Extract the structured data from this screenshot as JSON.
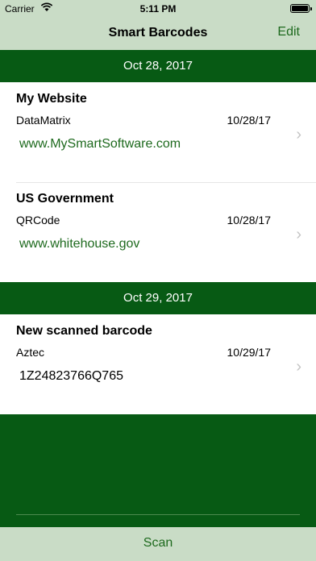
{
  "status": {
    "carrier": "Carrier",
    "time": "5:11 PM"
  },
  "nav": {
    "title": "Smart Barcodes",
    "edit_label": "Edit"
  },
  "sections": [
    {
      "header": "Oct 28, 2017",
      "items": [
        {
          "name": "My Website",
          "type": "DataMatrix",
          "date": "10/28/17",
          "content": "www.MySmartSoftware.com"
        },
        {
          "name": "US Government",
          "type": "QRCode",
          "date": "10/28/17",
          "content": "www.whitehouse.gov"
        }
      ]
    },
    {
      "header": "Oct 29, 2017",
      "items": [
        {
          "name": "New scanned barcode",
          "type": "Aztec",
          "date": "10/29/17",
          "content": "1Z24823766Q765"
        }
      ]
    }
  ],
  "toolbar": {
    "scan_label": "Scan"
  },
  "colors": {
    "bar_background": "#c9dcc6",
    "section_green": "#075a14",
    "link_green": "#1e6a1e"
  }
}
